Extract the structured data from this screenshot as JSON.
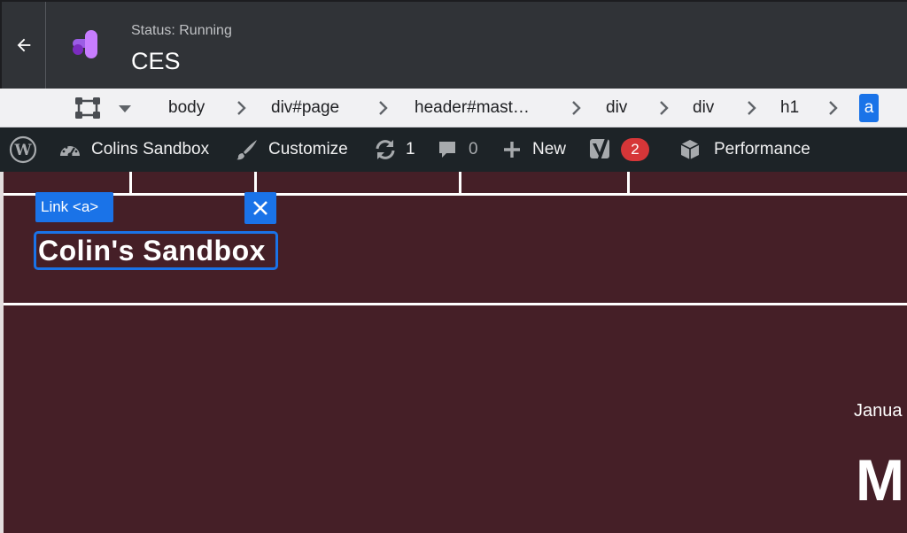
{
  "app": {
    "status": "Status: Running",
    "title": "CES",
    "accent_color": "#1a73e8",
    "back_icon": "arrow-left-icon",
    "logo_icon": "purple-tag-manager-logo"
  },
  "breadcrumb": {
    "items": [
      "body",
      "div#page",
      "header#mast…",
      "div",
      "div",
      "h1"
    ],
    "active": "a",
    "frame_icon": "frame-select-icon",
    "dropdown_icon": "caret-down-icon",
    "separator_icon": "chevron-right-icon"
  },
  "wp_admin_bar": {
    "wp_logo": "wordpress-logo-icon",
    "site_name": "Colins Sandbox",
    "customize": "Customize",
    "updates_count": "1",
    "comments_count": "0",
    "new_label": "New",
    "yoast_badge": "2",
    "performance": "Performance"
  },
  "page": {
    "background": "#451f27",
    "selection_label": "Link <a>",
    "site_title": "Colin's Sandbox",
    "date_fragment": "Janua",
    "heading_fragment": "M"
  }
}
